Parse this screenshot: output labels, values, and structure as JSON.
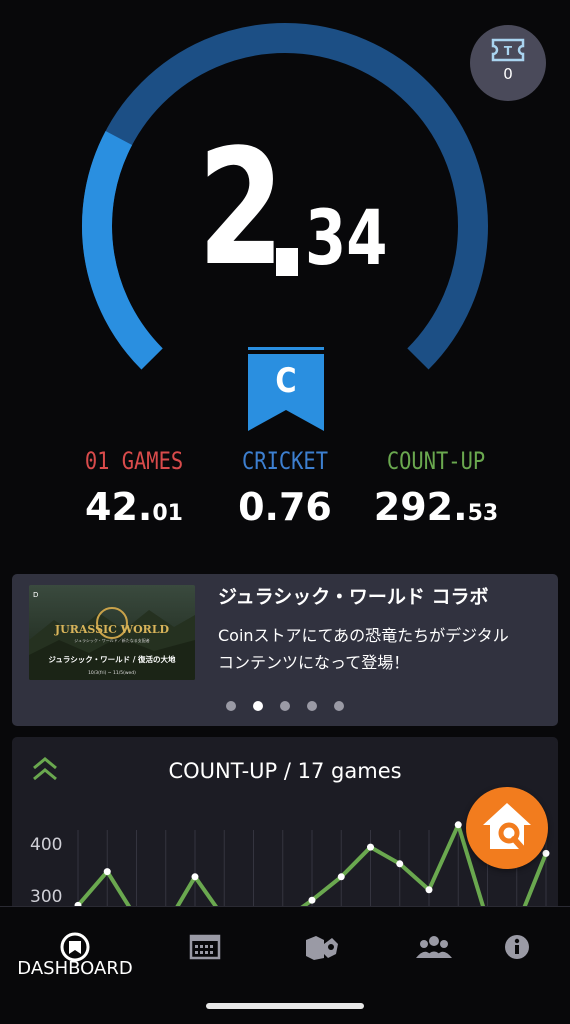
{
  "rating": {
    "integer": "2",
    "decimal": "34",
    "rank_letter": "C"
  },
  "colors": {
    "gauge_bright": "#2a8fe0",
    "gauge_dark": "#1c4f85",
    "ribbon": "#2a8fe0",
    "games01": "#d94b4b",
    "cricket": "#3d7fd0",
    "countup": "#6aa84f",
    "fab": "#f27c1e"
  },
  "gauge": {
    "level_fraction": 0.27
  },
  "ticket": {
    "icon": "ticket-icon",
    "count": "0"
  },
  "stats": [
    {
      "label": "01 GAMES",
      "value_main": "42.",
      "value_small": "01"
    },
    {
      "label": "CRICKET",
      "value_main": "0.76",
      "value_small": ""
    },
    {
      "label": "COUNT-UP",
      "value_main": "292.",
      "value_small": "53"
    }
  ],
  "banner": {
    "image_title": "JURASSIC WORLD",
    "image_subtitle": "ジュラシック・ワールド／新たなる支配者",
    "image_caption": "ジュラシック・ワールド / 復活の大地",
    "image_dates": "10/3(fri) ~ 11/5(wed)",
    "title": "ジュラシック・ワールド コラボ",
    "text_line1": "Coinストアにてあの恐竜たちがデジタル",
    "text_line2": "コンテンツになって登場！",
    "slides": 5,
    "active_slide": 1
  },
  "countup_card": {
    "title": "COUNT-UP / 17 games",
    "y_ticks": [
      "400",
      "300"
    ]
  },
  "chart_data": {
    "type": "line",
    "title": "COUNT-UP / 17 games",
    "x": [
      1,
      2,
      3,
      4,
      5,
      6,
      7,
      8,
      9,
      10,
      11,
      12,
      13,
      14,
      15,
      16,
      17
    ],
    "series": [
      {
        "values": [
          280,
          345,
          255,
          240,
          335,
          255,
          230,
          250,
          290,
          335,
          392,
          360,
          310,
          435,
          250,
          240,
          380
        ]
      }
    ],
    "yticks": [
      300,
      400
    ],
    "ylim_visible": [
      280,
      460
    ],
    "grid": true
  },
  "nav": {
    "items": [
      {
        "icon": "dashboard-icon",
        "label": "DASHBOARD"
      },
      {
        "icon": "calendar-icon",
        "label": ""
      },
      {
        "icon": "award-icon",
        "label": ""
      },
      {
        "icon": "friends-icon",
        "label": ""
      },
      {
        "icon": "info-icon",
        "label": ""
      }
    ]
  }
}
